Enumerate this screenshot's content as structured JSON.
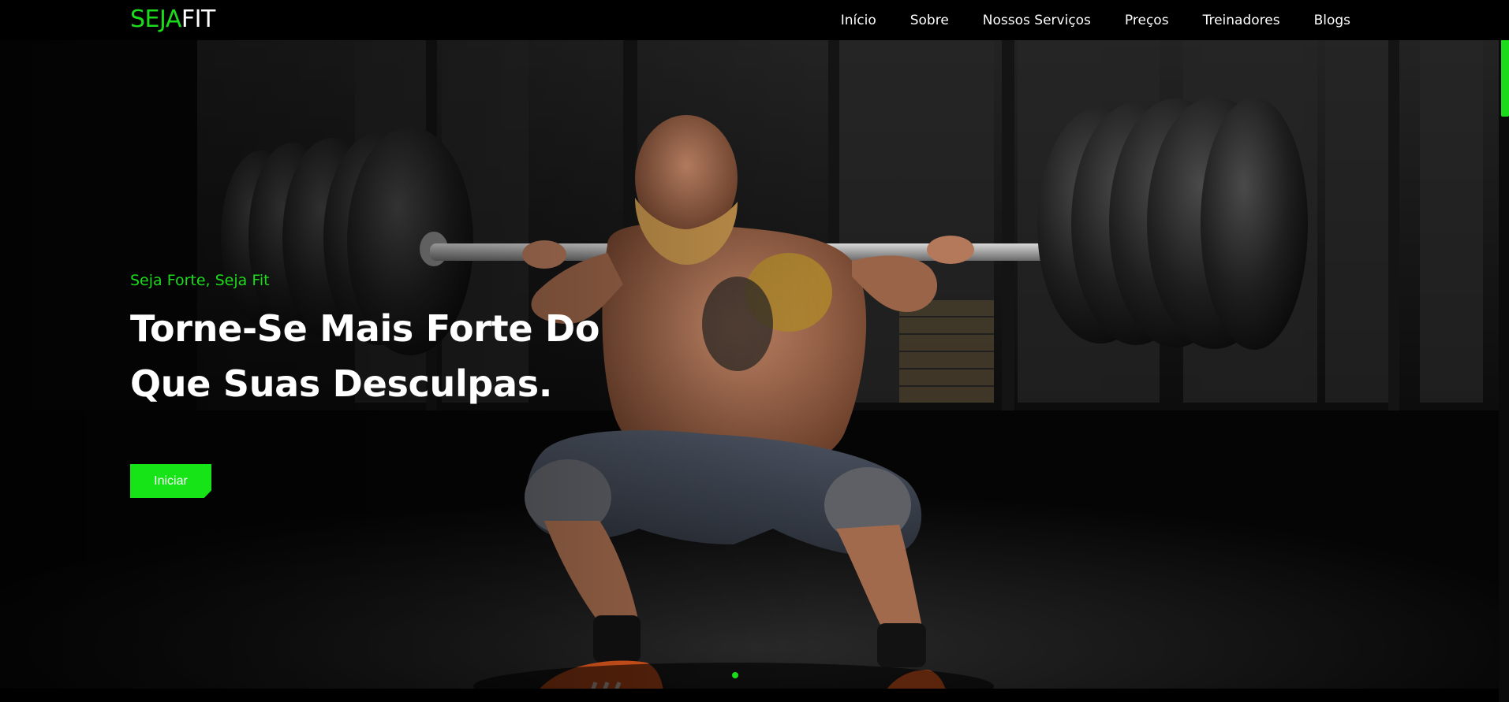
{
  "header": {
    "logo_accent": "SEJA",
    "logo_rest": "FIT",
    "nav": [
      {
        "label": "Início"
      },
      {
        "label": "Sobre"
      },
      {
        "label": "Nossos Serviços"
      },
      {
        "label": "Preços"
      },
      {
        "label": "Treinadores"
      },
      {
        "label": "Blogs"
      }
    ]
  },
  "hero": {
    "subtitle": "Seja Forte, Seja Fit",
    "title_line1": "Torne-Se Mais Forte Do",
    "title_line2": "Que Suas Desculpas.",
    "button_label": "Iniciar"
  },
  "colors": {
    "accent": "#1bdb1b",
    "background": "#000000",
    "text": "#ffffff"
  }
}
